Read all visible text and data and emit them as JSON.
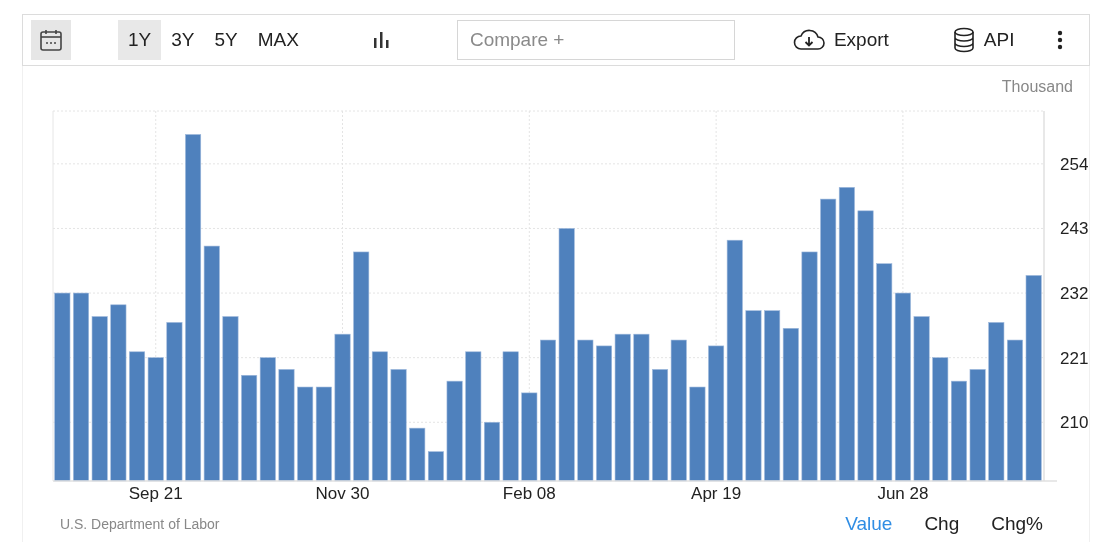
{
  "toolbar": {
    "ranges": [
      {
        "label": "1Y",
        "selected": true
      },
      {
        "label": "3Y",
        "selected": false
      },
      {
        "label": "5Y",
        "selected": false
      },
      {
        "label": "MAX",
        "selected": false
      }
    ],
    "compare": {
      "placeholder": "Compare +"
    },
    "actions": [
      {
        "kind": "export",
        "label": "Export"
      },
      {
        "kind": "api",
        "label": "API"
      }
    ]
  },
  "unit": "Thousand",
  "chart_data": {
    "type": "bar",
    "grid": true,
    "ylim": [
      200,
      263
    ],
    "yticks": [
      210,
      221,
      232,
      243,
      254
    ],
    "categories": [
      null,
      null,
      null,
      null,
      null,
      "Sep 21",
      null,
      null,
      null,
      null,
      null,
      null,
      null,
      null,
      null,
      "Nov 30",
      null,
      null,
      null,
      null,
      null,
      null,
      null,
      null,
      null,
      "Feb 08",
      null,
      null,
      null,
      null,
      null,
      null,
      null,
      null,
      null,
      "Apr 19",
      null,
      null,
      null,
      null,
      null,
      null,
      null,
      null,
      null,
      "Jun 28",
      null,
      null,
      null,
      null,
      null,
      null,
      null
    ],
    "series": [
      {
        "color": "#4f81bd",
        "values": [
          232,
          232,
          228,
          230,
          222,
          221,
          227,
          259,
          240,
          228,
          218,
          221,
          219,
          216,
          216,
          225,
          239,
          222,
          219,
          209,
          205,
          217,
          222,
          210,
          222,
          215,
          224,
          243,
          224,
          223,
          225,
          225,
          219,
          224,
          216,
          223,
          241,
          229,
          229,
          226,
          239,
          248,
          250,
          246,
          237,
          232,
          228,
          221,
          217,
          219,
          227,
          224,
          235
        ]
      }
    ]
  },
  "source": "U.S. Department of Labor",
  "views": [
    {
      "label": "Value",
      "selected": true
    },
    {
      "label": "Chg",
      "selected": false
    },
    {
      "label": "Chg%",
      "selected": false
    }
  ]
}
